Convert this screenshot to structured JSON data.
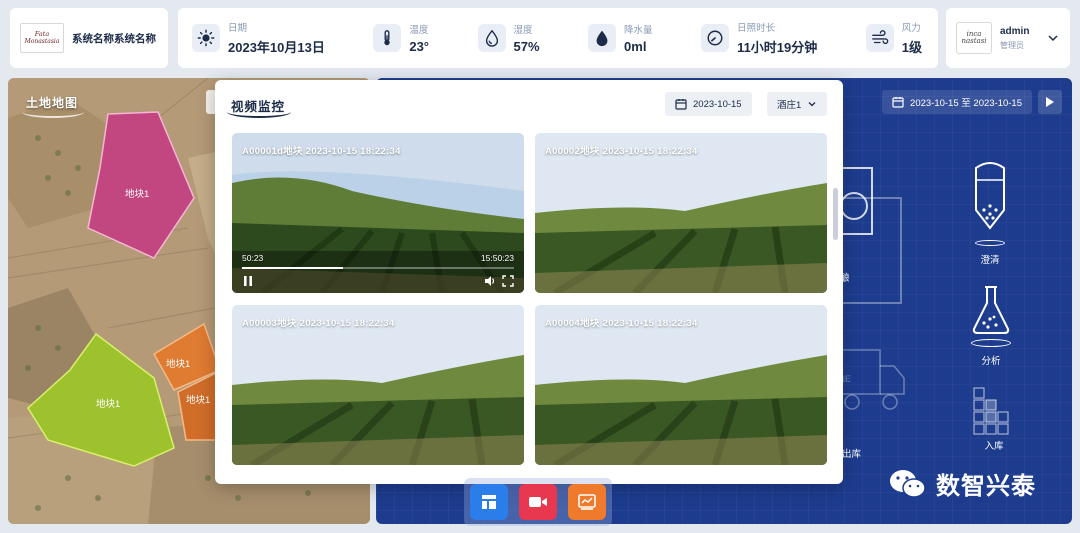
{
  "brand": {
    "logo_text_line1": "Fata",
    "logo_text_line2": "Monastasia",
    "system_name": "系统名称系统名称"
  },
  "weather": {
    "items": [
      {
        "label": "日期",
        "value": "2023年10月13日",
        "icon": "sun-icon"
      },
      {
        "label": "温度",
        "value": "23°",
        "icon": "thermometer-icon"
      },
      {
        "label": "湿度",
        "value": "57%",
        "icon": "humidity-icon"
      },
      {
        "label": "降水量",
        "value": "0ml",
        "icon": "rain-drop-icon"
      },
      {
        "label": "日照时长",
        "value": "11小时19分钟",
        "icon": "clock-icon"
      },
      {
        "label": "风力",
        "value": "1级",
        "icon": "wind-icon"
      }
    ]
  },
  "user": {
    "avatar_line1": "inca",
    "avatar_line2": "nastasi",
    "name": "admin",
    "role": "管理员"
  },
  "map": {
    "title": "土地地图",
    "plots": [
      {
        "label": "地块1",
        "color": "#c2467f"
      },
      {
        "label": "地块1",
        "color": "#9ec12e"
      },
      {
        "label": "地块1",
        "color": "#e07b32"
      },
      {
        "label": "地块1",
        "color": "#d06d29"
      }
    ]
  },
  "process": {
    "date_range": "2023-10-15 至 2023-10-15",
    "stages": [
      {
        "label": "澄清"
      },
      {
        "label": "分析"
      },
      {
        "label": "入库"
      },
      {
        "label": "酿"
      },
      {
        "label": "出库"
      }
    ],
    "truck_text": "INE"
  },
  "modal": {
    "title": "视频监控",
    "date": "2023-10-15",
    "winery": "酒庄1",
    "videos": [
      {
        "title": "A00001d地块  2023-10-15  18:22:34",
        "elapsed": "50:23",
        "total": "15:50:23",
        "progress": 0.37
      },
      {
        "title": "A00002地块  2023-10-15  18:22:34"
      },
      {
        "title": "A00003地块  2023-10-15  18:22:34"
      },
      {
        "title": "A00004地块  2023-10-15  18:22:34"
      }
    ]
  },
  "dock": {
    "items": [
      {
        "icon": "layout-icon",
        "color": "#2b7de9"
      },
      {
        "icon": "video-camera-icon",
        "color": "#e8384f"
      },
      {
        "icon": "report-icon",
        "color": "#ef7a2b"
      }
    ]
  },
  "watermark": {
    "text": "数智兴泰"
  }
}
